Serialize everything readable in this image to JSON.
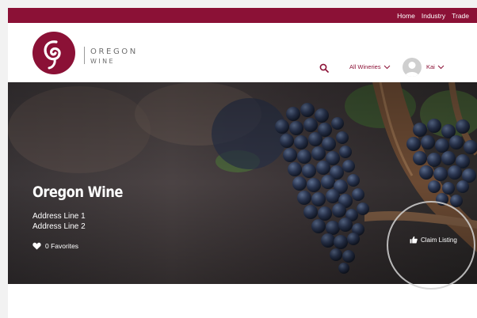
{
  "top_nav": {
    "links": [
      "Home",
      "Industry",
      "Trade"
    ]
  },
  "brand": {
    "name_line1": "OREGON",
    "name_line2": "WINE",
    "color": "#8b1136"
  },
  "header": {
    "wineries_dropdown": "All Wineries",
    "user_name": "Kai"
  },
  "winery": {
    "name": "Oregon Wine",
    "address_line1": "Address Line 1",
    "address_line2": "Address Line 2",
    "favorites": "0 Favorites",
    "claim_label": "Claim Listing"
  },
  "icons": {
    "search": "search-icon",
    "chevron": "chevron-down-icon",
    "user": "user-avatar-icon",
    "heart": "heart-icon",
    "thumb": "thumbs-up-icon"
  }
}
